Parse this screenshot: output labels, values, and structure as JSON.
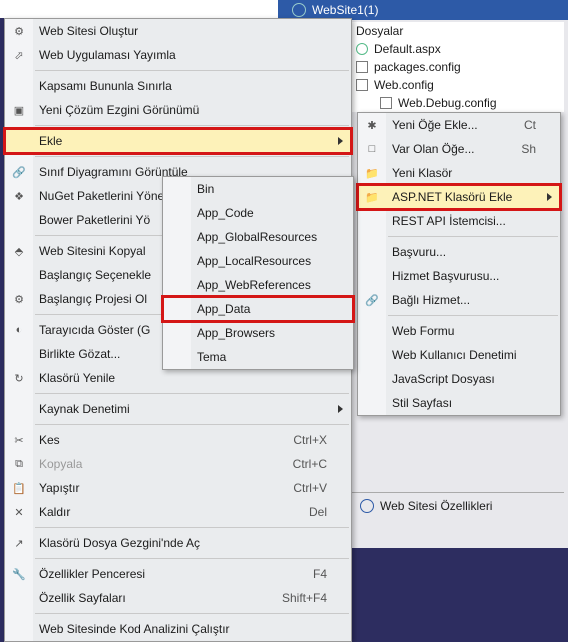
{
  "solution": {
    "root": "WebSite1(1)",
    "files": [
      "Dosyalar",
      "Default.aspx",
      "packages.config",
      "Web.config",
      "Web.Debug.config"
    ]
  },
  "menu1": {
    "items": [
      {
        "label": "Web Sitesi Oluştur",
        "icon": "⚙"
      },
      {
        "label": "Web Uygulaması Yayımla",
        "icon": "⬀"
      },
      {
        "sep": true
      },
      {
        "label": "Kapsamı Bununla Sınırla"
      },
      {
        "label": "Yeni Çözüm Ezgini Görünümü",
        "icon": "▣"
      },
      {
        "sep": true
      },
      {
        "label": "Ekle",
        "arrow": true,
        "highlight": true
      },
      {
        "sep": true
      },
      {
        "label": "Sınıf Diyagramını Görüntüle",
        "icon": "🔗"
      },
      {
        "label": "NuGet Paketlerini Yönet...",
        "icon": "❖"
      },
      {
        "label": "Bower Paketlerini Yö"
      },
      {
        "sep": true
      },
      {
        "label": "Web Sitesini Kopyal",
        "icon": "⬘"
      },
      {
        "label": "Başlangıç Seçenekle"
      },
      {
        "label": "Başlangıç Projesi Ol",
        "icon": "⚙"
      },
      {
        "sep": true
      },
      {
        "label": "Tarayıcıda Göster (G",
        "icon": "◐"
      },
      {
        "label": "Birlikte Gözat...",
        "arrow": true
      },
      {
        "label": "Klasörü Yenile",
        "icon": "↻"
      },
      {
        "sep": true
      },
      {
        "label": "Kaynak Denetimi",
        "arrow": true
      },
      {
        "sep": true
      },
      {
        "label": "Kes",
        "icon": "✂",
        "shortcut": "Ctrl+X"
      },
      {
        "label": "Kopyala",
        "icon": "⧉",
        "shortcut": "Ctrl+C",
        "disabled": true
      },
      {
        "label": "Yapıştır",
        "icon": "📋",
        "shortcut": "Ctrl+V"
      },
      {
        "label": "Kaldır",
        "icon": "✕",
        "shortcut": "Del"
      },
      {
        "sep": true
      },
      {
        "label": "Klasörü Dosya Gezgini'nde Aç",
        "icon": "↗"
      },
      {
        "sep": true
      },
      {
        "label": "Özellikler Penceresi",
        "icon": "🔧",
        "shortcut": "F4"
      },
      {
        "label": "Özellik Sayfaları",
        "shortcut": "Shift+F4"
      },
      {
        "sep": true
      },
      {
        "label": "Web Sitesinde Kod Analizini Çalıştır"
      }
    ]
  },
  "menu2": {
    "items": [
      {
        "label": "Bin"
      },
      {
        "label": "App_Code"
      },
      {
        "label": "App_GlobalResources"
      },
      {
        "label": "App_LocalResources"
      },
      {
        "label": "App_WebReferences"
      },
      {
        "label": "App_Data",
        "highlight": true
      },
      {
        "label": "App_Browsers"
      },
      {
        "label": "Tema"
      }
    ]
  },
  "menu3": {
    "items": [
      {
        "label": "Yeni Öğe Ekle...",
        "icon": "✱",
        "shortcut": "Ct"
      },
      {
        "label": "Var Olan Öğe...",
        "icon": "□",
        "shortcut": "Sh"
      },
      {
        "label": "Yeni Klasör",
        "icon": "📁"
      },
      {
        "label": "ASP.NET Klasörü Ekle",
        "icon": "📁",
        "arrow": true,
        "highlight": true,
        "hlbg": true
      },
      {
        "label": "REST API İstemcisi..."
      },
      {
        "sep": true
      },
      {
        "label": "Başvuru..."
      },
      {
        "label": "Hizmet Başvurusu..."
      },
      {
        "label": "Bağlı Hizmet...",
        "icon": "🔗"
      },
      {
        "sep": true
      },
      {
        "label": "Web Formu"
      },
      {
        "label": "Web Kullanıcı Denetimi"
      },
      {
        "label": "JavaScript Dosyası"
      },
      {
        "label": "Stil Sayfası"
      }
    ]
  },
  "properties": {
    "title": "Web Sitesi Özellikleri"
  }
}
